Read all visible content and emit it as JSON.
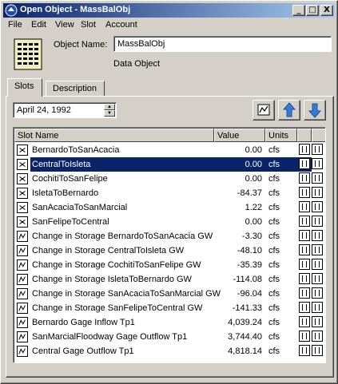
{
  "window": {
    "title": "Open Object - MassBalObj"
  },
  "titlebar_buttons": {
    "minimize": "_",
    "maximize": "□",
    "close": "X"
  },
  "menu": [
    "File",
    "Edit",
    "View",
    "Slot",
    "Account"
  ],
  "object": {
    "name_label": "Object Name:",
    "name_value": "MassBalObj",
    "type": "Data Object"
  },
  "tabs": [
    {
      "label": "Slots",
      "active": true
    },
    {
      "label": "Description",
      "active": false
    }
  ],
  "date": {
    "value": "April 24, 1992"
  },
  "table": {
    "columns": [
      "Slot Name",
      "Value",
      "Units"
    ],
    "rows": [
      {
        "icon": "series-slot-icon",
        "name": "BernardoToSanAcacia",
        "value": "0.00",
        "units": "cfs",
        "selected": false
      },
      {
        "icon": "series-slot-icon",
        "name": "CentralToIsleta",
        "value": "0.00",
        "units": "cfs",
        "selected": true
      },
      {
        "icon": "series-slot-icon",
        "name": "CochitiToSanFelipe",
        "value": "0.00",
        "units": "cfs",
        "selected": false
      },
      {
        "icon": "series-slot-icon",
        "name": "IsletaToBernardo",
        "value": "-84.37",
        "units": "cfs",
        "selected": false
      },
      {
        "icon": "series-slot-icon",
        "name": "SanAcaciaToSanMarcial",
        "value": "1.22",
        "units": "cfs",
        "selected": false
      },
      {
        "icon": "series-slot-icon",
        "name": "SanFelipeToCentral",
        "value": "0.00",
        "units": "cfs",
        "selected": false
      },
      {
        "icon": "graph-slot-icon",
        "name": "Change in Storage BernardoToSanAcacia GW",
        "value": "-3.30",
        "units": "cfs",
        "selected": false
      },
      {
        "icon": "graph-slot-icon",
        "name": "Change in Storage CentralToIsleta GW",
        "value": "-48.10",
        "units": "cfs",
        "selected": false
      },
      {
        "icon": "graph-slot-icon",
        "name": "Change in Storage CochitiToSanFelipe GW",
        "value": "-35.39",
        "units": "cfs",
        "selected": false
      },
      {
        "icon": "graph-slot-icon",
        "name": "Change in Storage IsletaToBernardo GW",
        "value": "-114.08",
        "units": "cfs",
        "selected": false
      },
      {
        "icon": "graph-slot-icon",
        "name": "Change in Storage SanAcaciaToSanMarcial GW",
        "value": "-96.04",
        "units": "cfs",
        "selected": false
      },
      {
        "icon": "graph-slot-icon",
        "name": "Change in Storage SanFelipeToCentral GW",
        "value": "-141.33",
        "units": "cfs",
        "selected": false
      },
      {
        "icon": "graph-slot-icon",
        "name": "Bernardo Gage Inflow Tp1",
        "value": "4,039.24",
        "units": "cfs",
        "selected": false
      },
      {
        "icon": "graph-slot-icon",
        "name": "SanMarcialFloodway Gage Outflow Tp1",
        "value": "3,744.40",
        "units": "cfs",
        "selected": false
      },
      {
        "icon": "graph-slot-icon",
        "name": "Central Gage Outflow Tp1",
        "value": "4,818.14",
        "units": "cfs",
        "selected": false
      }
    ]
  }
}
